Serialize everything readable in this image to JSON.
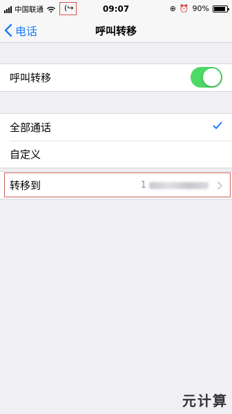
{
  "status_bar": {
    "carrier": "中国联通",
    "time": "09:07",
    "battery": "90%",
    "battery_level": 0.9
  },
  "nav": {
    "back_label": "电话",
    "title": "呼叫转移"
  },
  "toggle_row": {
    "label": "呼叫转移",
    "enabled": true
  },
  "options": [
    {
      "label": "全部通话",
      "selected": true
    },
    {
      "label": "自定义",
      "selected": false
    }
  ],
  "forward_row": {
    "label": "转移到",
    "value_prefix": "1"
  },
  "watermark": "元计算",
  "colors": {
    "accent": "#1a7cf6",
    "toggle_on": "#4cd964",
    "highlight_border": "#c9605a"
  }
}
